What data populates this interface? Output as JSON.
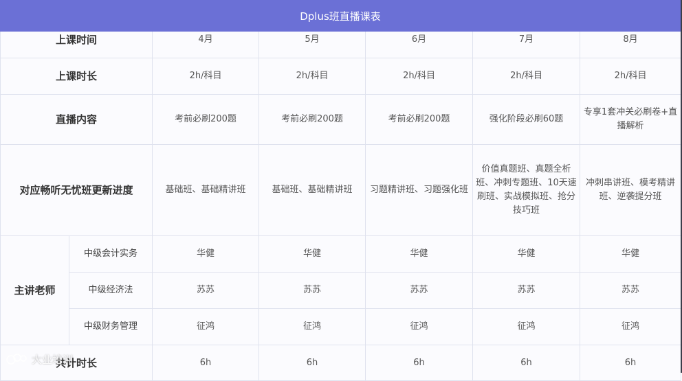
{
  "title": "Dplus班直播课表",
  "months": [
    "4月",
    "5月",
    "6月",
    "7月",
    "8月"
  ],
  "rows": {
    "time": {
      "label": "上课时间"
    },
    "duration": {
      "label": "上课时长",
      "values": [
        "2h/科目",
        "2h/科目",
        "2h/科目",
        "2h/科目",
        "2h/科目"
      ]
    },
    "content": {
      "label": "直播内容",
      "values": [
        "考前必刷200题",
        "考前必刷200题",
        "考前必刷200题",
        "强化阶段必刷60题",
        "专享1套冲关必刷卷+直播解析"
      ]
    },
    "progress": {
      "label": "对应畅听无忧班更新进度",
      "values": [
        "基础班、基础精讲班",
        "基础班、基础精讲班",
        "习题精讲班、习题强化班",
        "价值真题班、真题全析班、冲刺专题班、10天速刷班、实战模拟班、抢分技巧班",
        "冲刺串讲班、模考精讲班、逆袭提分班"
      ]
    },
    "teachers": {
      "label": "主讲老师",
      "subjects": [
        {
          "name": "中级会计实务",
          "values": [
            "华健",
            "华健",
            "华健",
            "华健",
            "华健"
          ]
        },
        {
          "name": "中级经济法",
          "values": [
            "苏苏",
            "苏苏",
            "苏苏",
            "苏苏",
            "苏苏"
          ]
        },
        {
          "name": "中级财务管理",
          "values": [
            "征鸿",
            "征鸿",
            "征鸿",
            "征鸿",
            "征鸿"
          ]
        }
      ]
    },
    "total": {
      "label": "共计时长",
      "values": [
        "6h",
        "6h",
        "6h",
        "6h",
        "6h"
      ]
    }
  },
  "watermark": {
    "text": "大业培训",
    "icon": "watermark-logo-icon"
  },
  "colors": {
    "header": "#6b70d6",
    "row_header_bg": "#eef0fd",
    "cell_bg": "#fbfbfe",
    "border": "#dfe2ee"
  }
}
